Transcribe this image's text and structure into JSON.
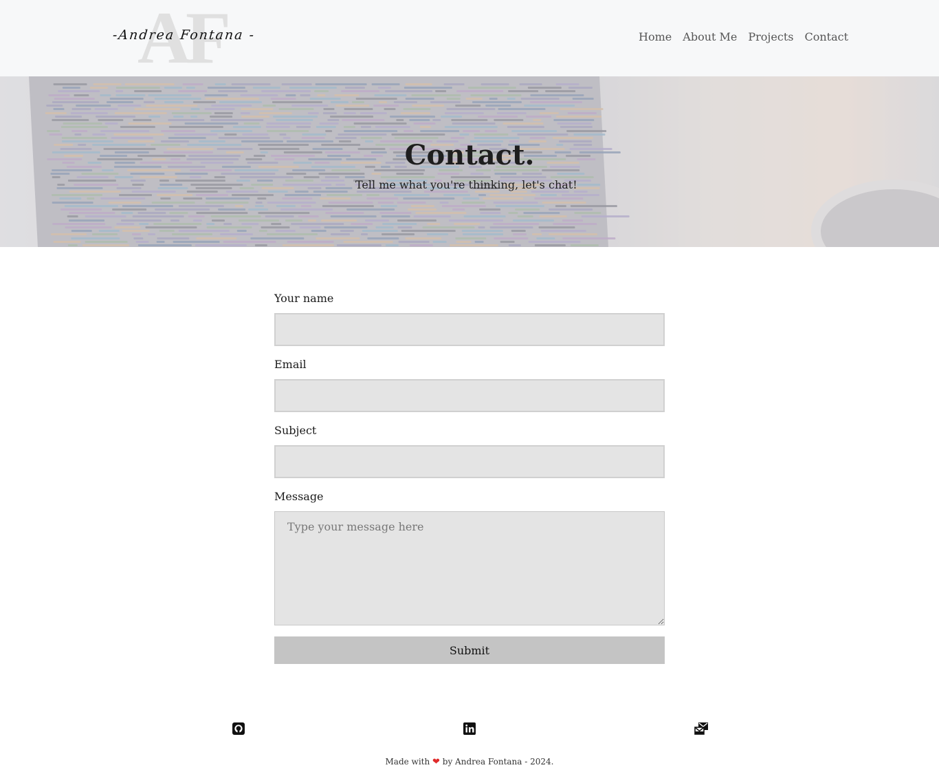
{
  "header": {
    "logo": {
      "monogram": "AF",
      "script": "-Andrea Fontana -"
    },
    "nav": [
      "Home",
      "About Me",
      "Projects",
      "Contact"
    ]
  },
  "hero": {
    "title": "Contact.",
    "subtitle": "Tell me what you're thinking, let's chat!"
  },
  "form": {
    "name_label": "Your name",
    "email_label": "Email",
    "subject_label": "Subject",
    "message_label": "Message",
    "message_placeholder": "Type your message here",
    "submit_label": "Submit"
  },
  "footer": {
    "icons": [
      "github-icon",
      "linkedin-icon",
      "mail-icon"
    ],
    "made_with": "Made with",
    "by": "by Andrea Fontana - 2024."
  },
  "colors": {
    "header_bg": "#f7f8f9",
    "field_bg": "#e4e4e4",
    "button_bg": "#c4c4c4",
    "heart": "#e02b2b"
  }
}
